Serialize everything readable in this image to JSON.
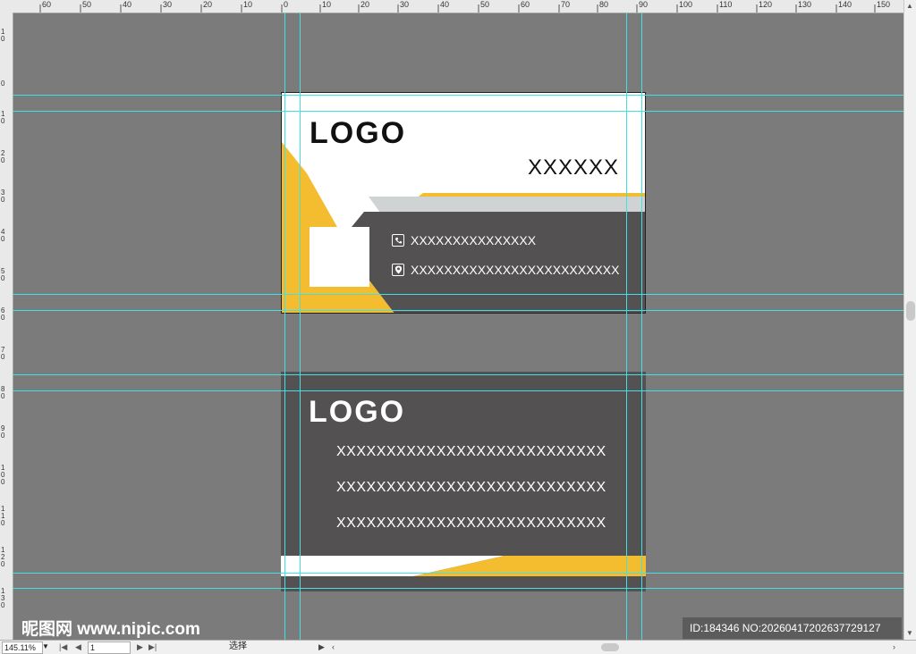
{
  "rulers": {
    "top_ticks": [
      "60",
      "50",
      "40",
      "30",
      "20",
      "10",
      "0",
      "10",
      "20",
      "30",
      "40",
      "50",
      "60",
      "70",
      "80",
      "90",
      "100",
      "110",
      "120",
      "130",
      "140",
      "150"
    ],
    "left_ticks": [
      "1 0",
      "0",
      "1 0",
      "2 0",
      "3 0",
      "4 0",
      "5 0",
      "6 0",
      "7 0",
      "8 0",
      "9 0",
      "1 0 0",
      "1 1 0",
      "1 2 0",
      "1 3 0"
    ]
  },
  "front_card": {
    "logo": "LOGO",
    "title": "XXXXXX",
    "phone": "XXXXXXXXXXXXXXX",
    "address": "XXXXXXXXXXXXXXXXXXXXXXXXX",
    "phone_icon": "phone-icon",
    "location_icon": "location-pin-icon"
  },
  "back_card": {
    "logo": "LOGO",
    "lines": [
      "XXXXXXXXXXXXXXXXXXXXXXXXXXX",
      "XXXXXXXXXXXXXXXXXXXXXXXXXXX",
      "XXXXXXXXXXXXXXXXXXXXXXXXXXX"
    ]
  },
  "colors": {
    "accent_yellow": "#f4bd30",
    "dark_gray": "#535151",
    "light_gray": "#d0d3d4",
    "guide": "#3fe0e6",
    "canvas": "#7b7b7b"
  },
  "status_bar": {
    "zoom": "145.11%",
    "page": "1",
    "tool": "选择"
  },
  "watermark": {
    "site": "昵图网 www.nipic.com",
    "id_text": "ID:184346 NO:20260417202637729127"
  }
}
